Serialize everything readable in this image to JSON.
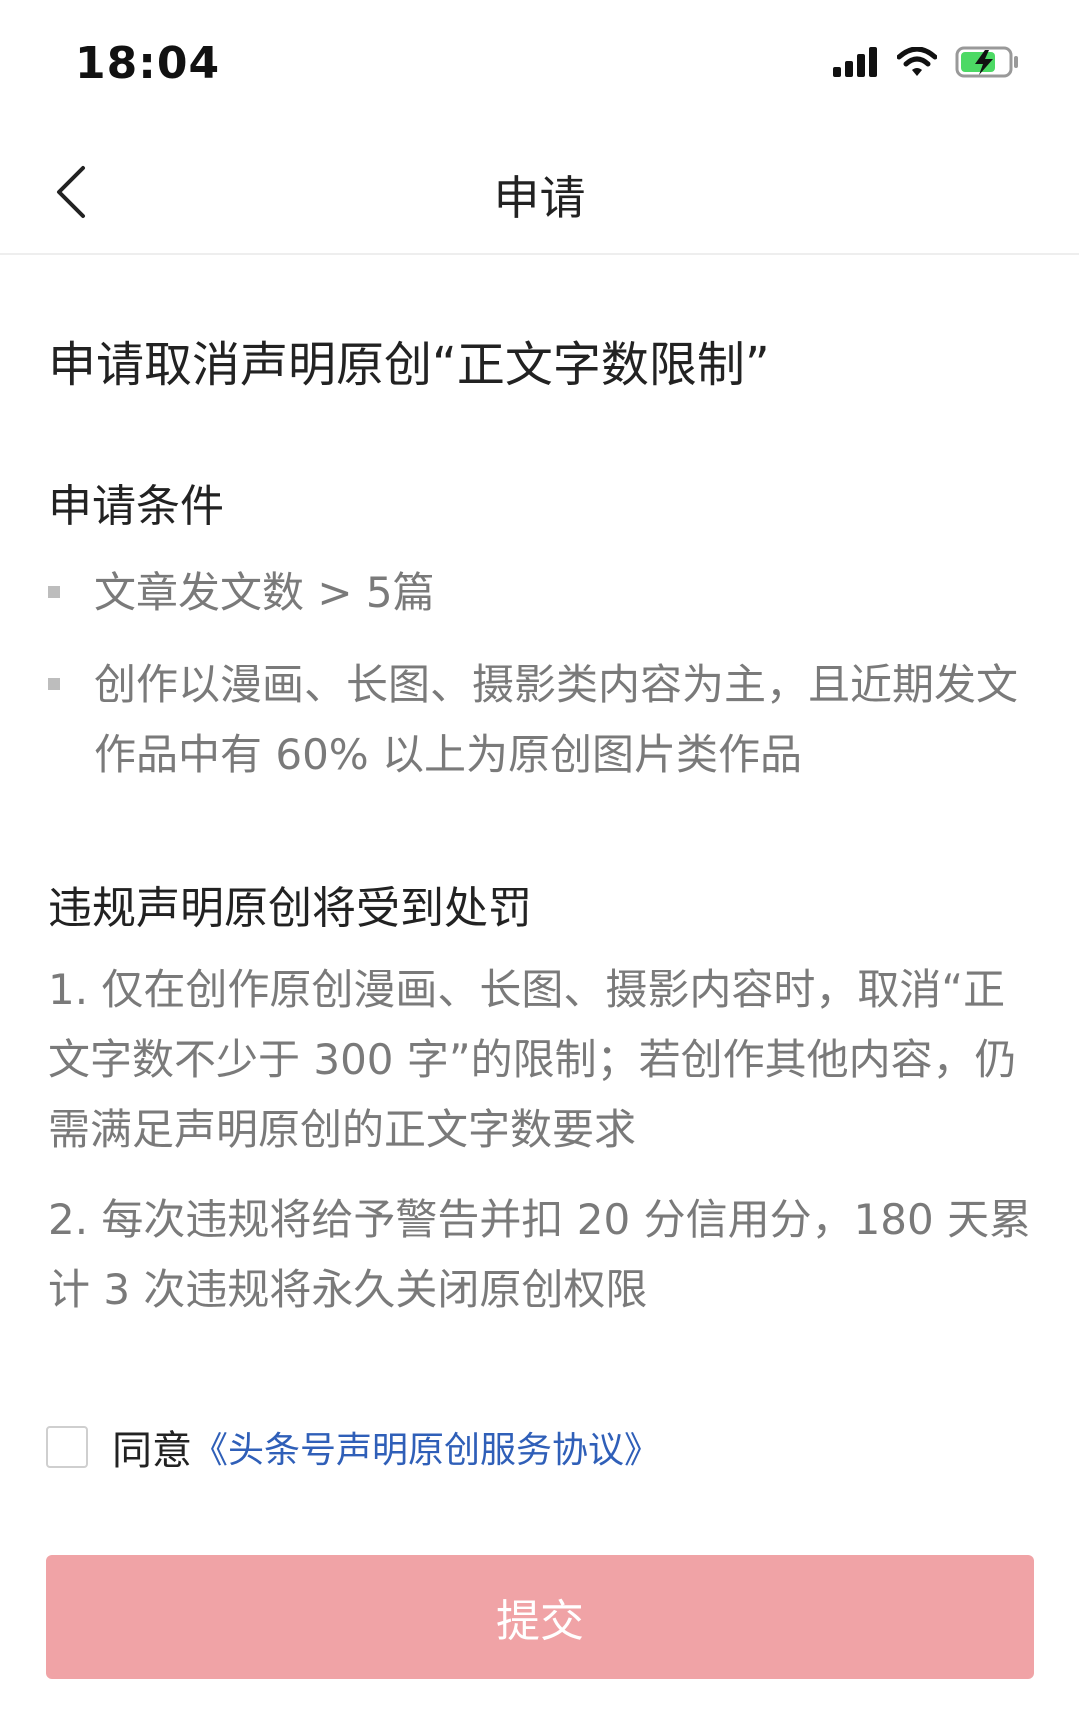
{
  "status_bar": {
    "time": "18:04",
    "icons": [
      "signal-icon",
      "wifi-icon",
      "battery-charging-icon"
    ],
    "battery_color": "#4cd964"
  },
  "nav": {
    "back_icon": "chevron-left-icon",
    "title": "申请"
  },
  "heading": "申请取消声明原创“正文字数限制”",
  "conditions": {
    "title": "申请条件",
    "items": [
      "文章发文数 > 5篇",
      "创作以漫画、长图、摄影类内容为主，且近期发文作品中有 60% 以上为原创图片类作品"
    ]
  },
  "penalty": {
    "title": "违规声明原创将受到处罚",
    "items": [
      "1. 仅在创作原创漫画、长图、摄影内容时，取消“正文字数不少于 300 字”的限制；若创作其他内容，仍需满足声明原创的正文字数要求",
      "2. 每次违规将给予警告并扣 20 分信用分，180 天累计 3 次违规将永久关闭原创权限"
    ]
  },
  "agreement": {
    "label": "同意",
    "link": "《头条号声明原创服务协议》",
    "checked": false
  },
  "submit": {
    "label": "提交",
    "color": "#f0a3a6"
  },
  "colors": {
    "link": "#2f5fb8",
    "muted_text": "#7a7a7a",
    "primary_text": "#222222"
  }
}
